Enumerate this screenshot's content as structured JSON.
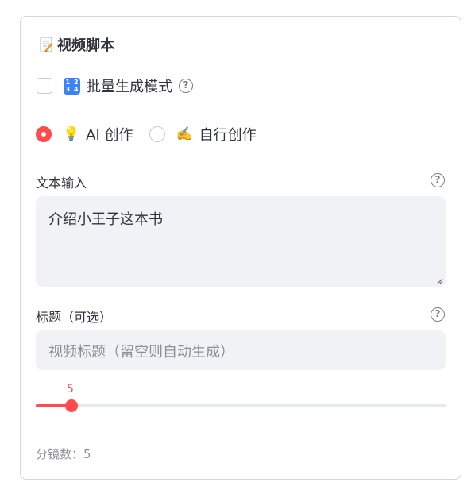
{
  "section": {
    "title": "视频脚本",
    "title_icon": "memo-icon"
  },
  "batch_mode": {
    "label": "批量生成模式",
    "checked": false,
    "icon": "1234-icon"
  },
  "mode": {
    "options": [
      {
        "emoji": "💡",
        "label": "AI 创作",
        "selected": true
      },
      {
        "emoji": "✍️",
        "label": "自行创作",
        "selected": false
      }
    ]
  },
  "text_input": {
    "label": "文本输入",
    "value": "介绍小王子这本书"
  },
  "title_input": {
    "label": "标题（可选）",
    "placeholder": "视频标题（留空则自动生成）",
    "value": ""
  },
  "slider": {
    "value": "5",
    "level": 0.087
  },
  "shot_count": {
    "text": "分镜数：5"
  },
  "colors": {
    "accent": "#ff4b4b",
    "field_bg": "#f0f2f6",
    "text": "#31333f",
    "muted": "#8d8f98"
  }
}
